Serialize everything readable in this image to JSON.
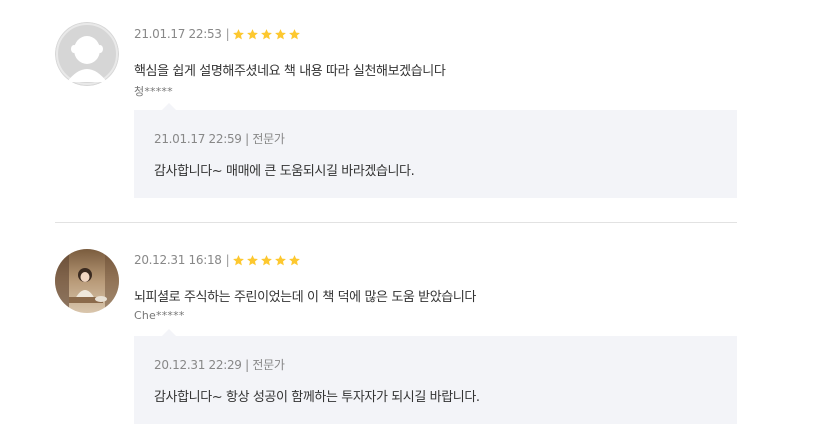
{
  "reviews": [
    {
      "date": "21.01.17 22:53",
      "rating": 5,
      "text": "핵심을 쉽게 설명해주셨네요 책 내용 따라 실천해보겠습니다",
      "author": "청*****",
      "avatar": "default-avatar",
      "reply": {
        "date": "21.01.17 22:59",
        "role": "전문가",
        "text": "감사합니다~ 매매에 큰 도움되시길 바라겠습니다."
      }
    },
    {
      "date": "20.12.31 16:18",
      "rating": 5,
      "text": "뇌피셜로 주식하는 주린이었는데 이 책 덕에 많은 도움 받았습니다",
      "author": "Che*****",
      "avatar": "photo-avatar",
      "reply": {
        "date": "20.12.31 22:29",
        "role": "전문가",
        "text": "감사합니다~ 항상 성공이 함께하는 투자자가 되시길 바랍니다."
      }
    }
  ],
  "colors": {
    "star": "#fdc82f",
    "reply_bg": "#f3f4f8",
    "divider": "#e2e2e2"
  }
}
